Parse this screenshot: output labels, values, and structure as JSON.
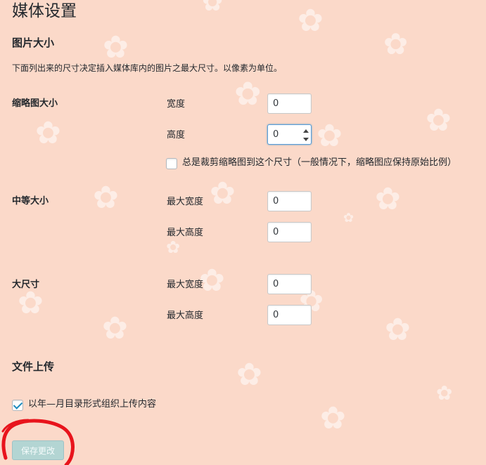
{
  "page": {
    "title": "媒体设置"
  },
  "image_sizes": {
    "heading": "图片大小",
    "description": "下面列出来的尺寸决定插入媒体库内的图片之最大尺寸。以像素为单位。",
    "thumbnail": {
      "label": "缩略图大小",
      "width_label": "宽度",
      "width_value": "0",
      "height_label": "高度",
      "height_value": "0",
      "crop_label": "总是裁剪缩略图到这个尺寸（一般情况下，缩略图应保持原始比例）",
      "crop_checked": false
    },
    "medium": {
      "label": "中等大小",
      "max_width_label": "最大宽度",
      "max_width_value": "0",
      "max_height_label": "最大高度",
      "max_height_value": "0"
    },
    "large": {
      "label": "大尺寸",
      "max_width_label": "最大宽度",
      "max_width_value": "0",
      "max_height_label": "最大高度",
      "max_height_value": "0"
    }
  },
  "uploads": {
    "heading": "文件上传",
    "organize_label": "以年—月目录形式组织上传内容",
    "organize_checked": true
  },
  "actions": {
    "save_label": "保存更改"
  },
  "colors": {
    "background": "#fbd9c9",
    "accent_blue": "#1e8cbe",
    "save_button": "#b3d5d3",
    "annotation_red": "#e8141c"
  },
  "decorations": {
    "background_pattern": "white-flower-icon",
    "annotation": "red-hand-drawn-circle"
  }
}
